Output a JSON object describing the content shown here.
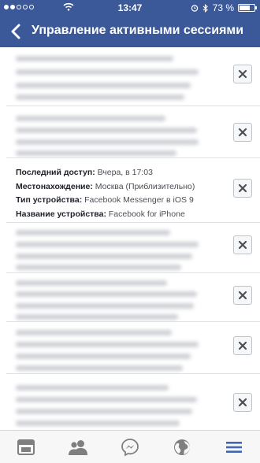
{
  "status_bar": {
    "time": "13:47",
    "battery": "73 %",
    "battery_level": 0.73,
    "signal_bars_filled": 2,
    "signal_bars_total": 5
  },
  "header": {
    "title": "Управление активными сессиями",
    "back_icon": "chevron-left-icon"
  },
  "sessions": [
    {
      "blurred": true
    },
    {
      "blurred": true
    },
    {
      "blurred": false,
      "last_access_label": "Последний доступ:",
      "last_access_value": "Вчера, в 17:03",
      "location_label": "Местонахождение:",
      "location_value": "Москва (Приблизительно)",
      "device_type_label": "Тип устройства:",
      "device_type_value": "Facebook Messenger в iOS 9",
      "device_name_label": "Название устройства:",
      "device_name_value": "Facebook for iPhone"
    },
    {
      "blurred": true
    },
    {
      "blurred": true
    },
    {
      "blurred": true
    },
    {
      "blurred": true
    }
  ],
  "tab_bar": {
    "tabs": [
      "news-feed-icon",
      "friends-icon",
      "messenger-icon",
      "globe-icon",
      "menu-icon"
    ],
    "active": "menu-icon"
  },
  "colors": {
    "brand": "#3b5998",
    "tab_inactive": "#7f7f7f",
    "tab_active": "#4267b2"
  }
}
